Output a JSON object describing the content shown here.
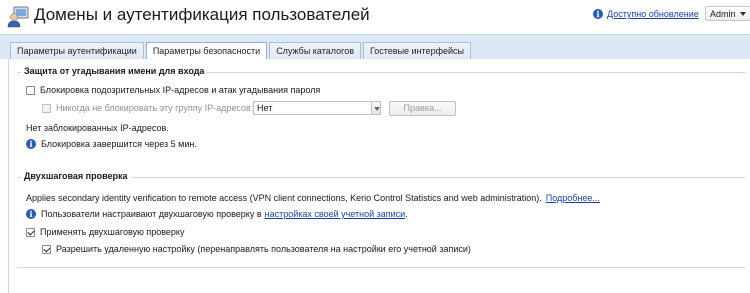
{
  "header": {
    "title": "Домены и аутентификация пользователей",
    "update_link": "Доступно обновление",
    "user": "Admin",
    "info_glyph": "i"
  },
  "tabs": [
    {
      "label": "Параметры аутентификации",
      "active": false
    },
    {
      "label": "Параметры безопасности",
      "active": true
    },
    {
      "label": "Службы каталогов",
      "active": false
    },
    {
      "label": "Гостевые интерфейсы",
      "active": false
    }
  ],
  "guessing": {
    "title": "Защита от угадывания имени для входа",
    "block_label": "Блокировка подозрительных IP-адресов и атак угадывания пароля",
    "block_checked": false,
    "never_block_label": "Никогда не блокировать эту группу IP-адресов:",
    "never_block_checked": false,
    "group_value": "Нет",
    "edit_button": "Правка...",
    "no_blocked": "Нет заблокированных IP-адресов.",
    "lock_info": "Блокировка завершится через 5 мин."
  },
  "twostep": {
    "title": "Двухшаговая проверка",
    "description": "Applies secondary identity verification to remote access (VPN client connections, Kerio Control Statistics and web administration).",
    "more_link": "Подробнее...",
    "info_prefix": "Пользователи настраивают двухшаговую проверку в",
    "info_link": "настройках своей учетной записи",
    "info_suffix": ".",
    "apply_label": "Применять двухшаговую проверку",
    "apply_checked": true,
    "remote_label": "Разрешить удаленную настройку (перенаправлять пользователя на настройки его учетной записи)",
    "remote_checked": true
  },
  "colors": {
    "tabbar_bg": "#dce8f6",
    "link": "#1a3fa8",
    "info_icon": "#2a5ab8"
  }
}
